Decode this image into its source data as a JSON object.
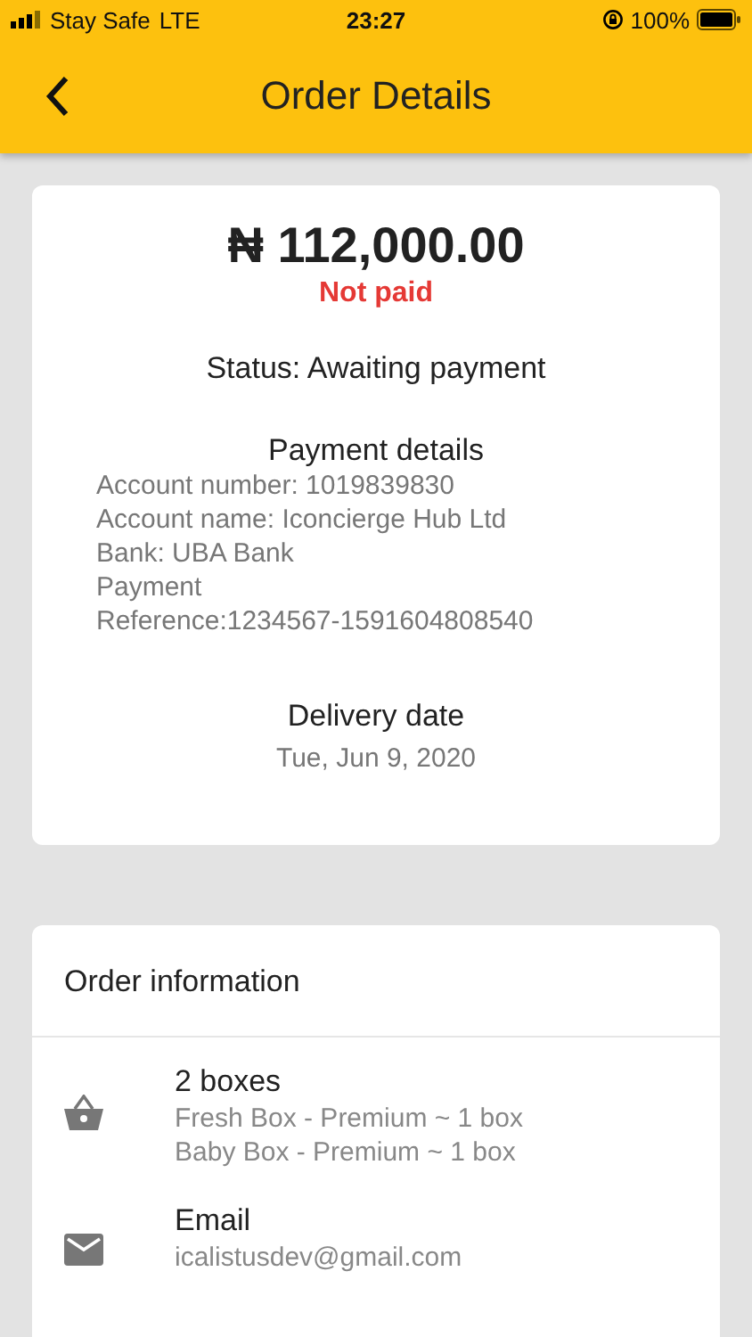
{
  "status_bar": {
    "carrier": "Stay Safe",
    "network": "LTE",
    "time": "23:27",
    "battery": "100%"
  },
  "header": {
    "title": "Order Details"
  },
  "summary": {
    "amount": "₦ 112,000.00",
    "payment_state": "Not paid",
    "status": "Status: Awaiting payment",
    "payment_details": {
      "title": "Payment details",
      "lines": [
        "Account number: 1019839830",
        "Account name: Iconcierge Hub Ltd",
        "Bank: UBA Bank",
        "Payment",
        "Reference:1234567-1591604808540"
      ]
    },
    "delivery": {
      "title": "Delivery date",
      "date": "Tue, Jun 9, 2020"
    }
  },
  "order_information": {
    "title": "Order information",
    "items": [
      {
        "kind": "basket",
        "title": "2  boxes",
        "lines": [
          "Fresh Box - Premium ~ 1 box",
          "Baby Box - Premium ~ 1 box"
        ]
      },
      {
        "kind": "email",
        "title": "Email",
        "lines": [
          "icalistusdev@gmail.com"
        ]
      }
    ]
  }
}
